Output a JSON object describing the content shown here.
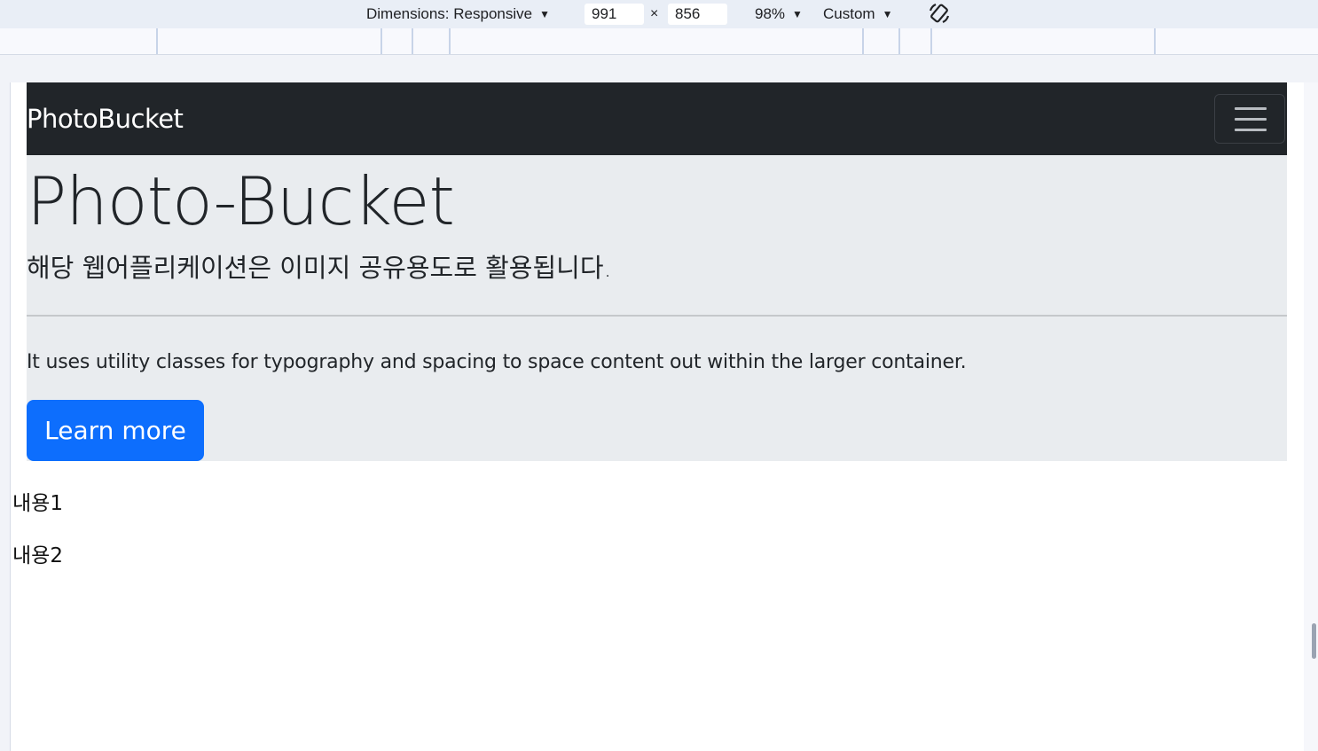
{
  "devtools": {
    "dimensions_label": "Dimensions: Responsive",
    "width": "991",
    "times": "×",
    "height": "856",
    "zoom": "98%",
    "throttle": "Custom",
    "rotate_icon": "rotate-icon"
  },
  "navbar": {
    "brand": "PhotoBucket",
    "toggler_icon": "hamburger-menu-icon",
    "background": "#212529"
  },
  "jumbotron": {
    "heading": "Photo-Bucket",
    "lead": "해당 웹어플리케이션은 이미지 공유용도로 활용됩니다.",
    "text": "It uses utility classes for typography and spacing to space content out within the larger container.",
    "button_label": "Learn more",
    "button_color": "#0d6efd",
    "background": "#e9ecef"
  },
  "content": {
    "item1": "내용1",
    "item2": "내용2"
  }
}
